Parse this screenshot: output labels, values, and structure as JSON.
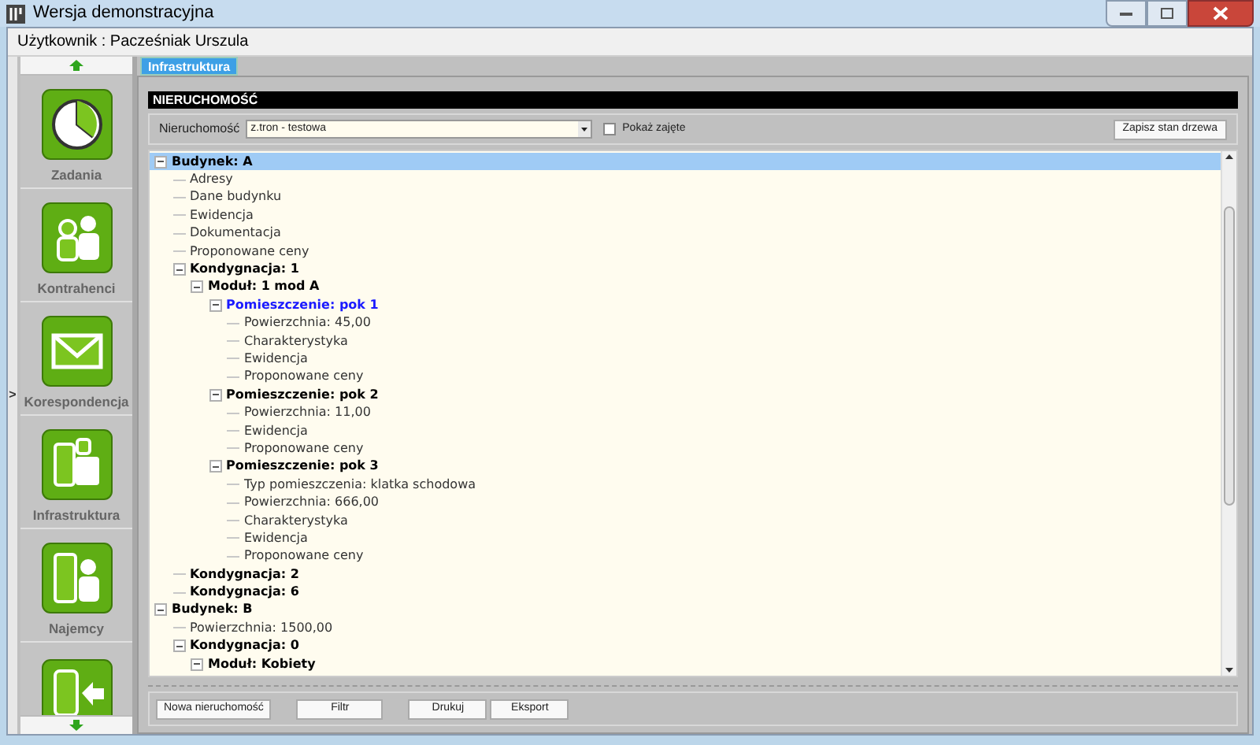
{
  "window": {
    "title": "Wersja demonstracyjna"
  },
  "user_bar": {
    "text": "Użytkownik : Pacześniak Urszula"
  },
  "sidebar": {
    "items": [
      {
        "label": "Zadania"
      },
      {
        "label": "Kontrahenci"
      },
      {
        "label": "Korespondencja"
      },
      {
        "label": "Infrastruktura"
      },
      {
        "label": "Najemcy"
      }
    ],
    "collapse_handle": ">"
  },
  "tabs": [
    {
      "label": "Infrastruktura",
      "selected": true
    }
  ],
  "panel": {
    "title": "NIERUCHOMOŚĆ",
    "filter": {
      "label": "Nieruchomość",
      "value": "z.tron - testowa",
      "show_occupied": {
        "label": "Pokaż zajęte",
        "checked": false
      },
      "save_button": "Zapisz stan drzewa"
    },
    "tree": [
      {
        "label": "Budynek: A",
        "kind": "group",
        "expanded": true,
        "selected": true,
        "current": false,
        "children": [
          {
            "label": "Adresy",
            "kind": "field",
            "selected": false,
            "current": false
          },
          {
            "label": "Dane budynku",
            "kind": "field",
            "selected": false,
            "current": false
          },
          {
            "label": "Ewidencja",
            "kind": "field",
            "selected": false,
            "current": false
          },
          {
            "label": "Dokumentacja",
            "kind": "field",
            "selected": false,
            "current": false
          },
          {
            "label": "Proponowane ceny",
            "kind": "field",
            "selected": false,
            "current": false
          },
          {
            "label": "Kondygnacja: 1",
            "kind": "group",
            "expanded": true,
            "selected": false,
            "current": false,
            "children": [
              {
                "label": "Moduł: 1 mod A",
                "kind": "group",
                "expanded": true,
                "selected": false,
                "current": false,
                "children": [
                  {
                    "label": "Pomieszczenie: pok 1",
                    "kind": "group",
                    "expanded": true,
                    "selected": false,
                    "current": true,
                    "children": [
                      {
                        "label": "Powierzchnia: 45,00",
                        "kind": "field",
                        "selected": false,
                        "current": false
                      },
                      {
                        "label": "Charakterystyka",
                        "kind": "field",
                        "selected": false,
                        "current": false
                      },
                      {
                        "label": "Ewidencja",
                        "kind": "field",
                        "selected": false,
                        "current": false
                      },
                      {
                        "label": "Proponowane ceny",
                        "kind": "field",
                        "selected": false,
                        "current": false
                      }
                    ]
                  },
                  {
                    "label": "Pomieszczenie: pok 2",
                    "kind": "group",
                    "expanded": true,
                    "selected": false,
                    "current": false,
                    "children": [
                      {
                        "label": "Powierzchnia: 11,00",
                        "kind": "field",
                        "selected": false,
                        "current": false
                      },
                      {
                        "label": "Ewidencja",
                        "kind": "field",
                        "selected": false,
                        "current": false
                      },
                      {
                        "label": "Proponowane ceny",
                        "kind": "field",
                        "selected": false,
                        "current": false
                      }
                    ]
                  },
                  {
                    "label": "Pomieszczenie: pok 3",
                    "kind": "group",
                    "expanded": true,
                    "selected": false,
                    "current": false,
                    "children": [
                      {
                        "label": "Typ pomieszczenia: klatka schodowa",
                        "kind": "field",
                        "selected": false,
                        "current": false
                      },
                      {
                        "label": "Powierzchnia: 666,00",
                        "kind": "field",
                        "selected": false,
                        "current": false
                      },
                      {
                        "label": "Charakterystyka",
                        "kind": "field",
                        "selected": false,
                        "current": false
                      },
                      {
                        "label": "Ewidencja",
                        "kind": "field",
                        "selected": false,
                        "current": false
                      },
                      {
                        "label": "Proponowane ceny",
                        "kind": "field",
                        "selected": false,
                        "current": false
                      }
                    ]
                  }
                ]
              }
            ]
          },
          {
            "label": "Kondygnacja: 2",
            "kind": "group",
            "selected": false,
            "current": false
          },
          {
            "label": "Kondygnacja: 6",
            "kind": "group",
            "selected": false,
            "current": false
          }
        ]
      },
      {
        "label": "Budynek: B",
        "kind": "group",
        "expanded": true,
        "selected": false,
        "current": false,
        "children": [
          {
            "label": "Powierzchnia: 1500,00",
            "kind": "field",
            "selected": false,
            "current": false
          },
          {
            "label": "Kondygnacja: 0",
            "kind": "group",
            "expanded": true,
            "selected": false,
            "current": false,
            "children": [
              {
                "label": "Moduł: Kobiety",
                "kind": "group",
                "expanded": true,
                "selected": false,
                "current": false
              }
            ]
          }
        ]
      }
    ],
    "buttons": [
      "Nowa nieruchomość",
      "Filtr",
      "Drukuj",
      "Eksport"
    ]
  }
}
